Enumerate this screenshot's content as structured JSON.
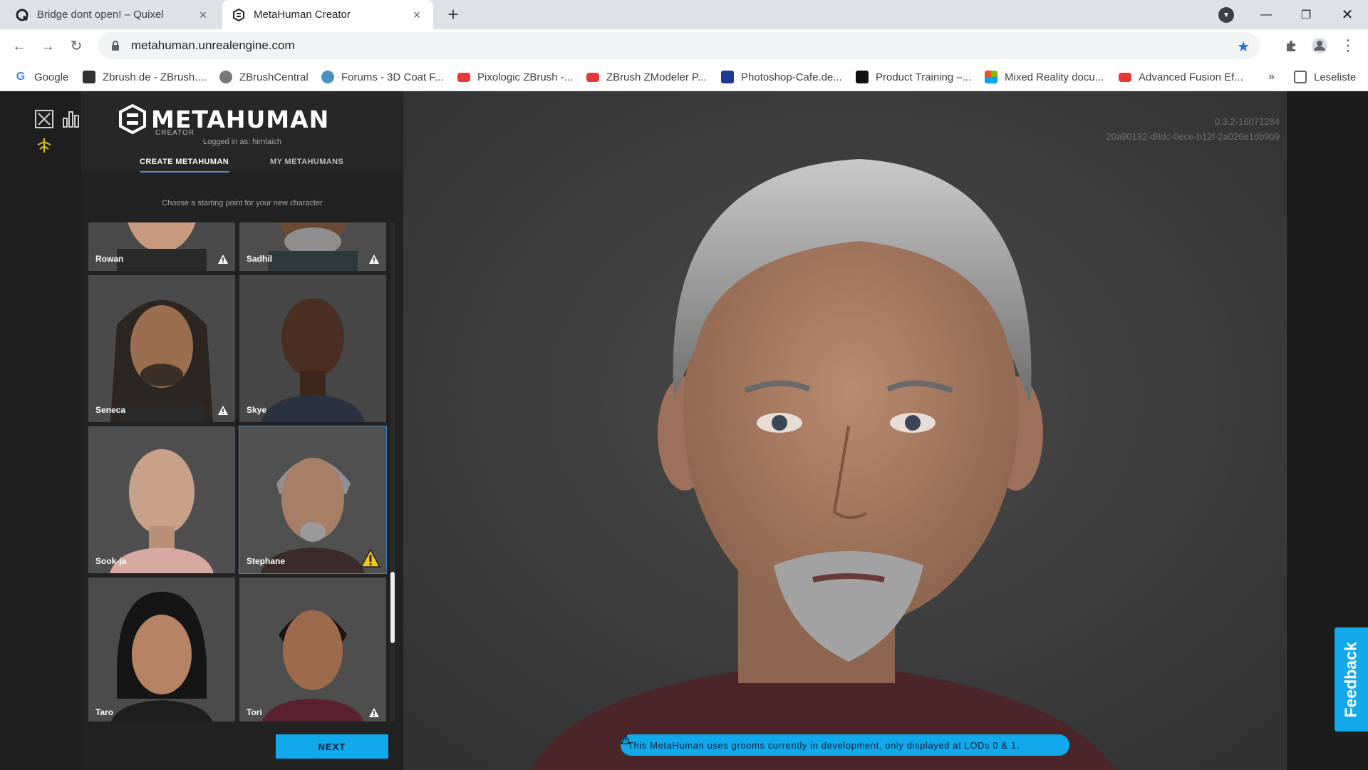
{
  "browser": {
    "tabs": [
      {
        "title": "Bridge dont open! – Quixel",
        "active": false
      },
      {
        "title": "MetaHuman Creator",
        "active": true
      }
    ],
    "url": "metahuman.unrealengine.com",
    "bookmarks": [
      {
        "label": "Google",
        "color": "#4285f4"
      },
      {
        "label": "Zbrush.de - ZBrush....",
        "color": "#333333"
      },
      {
        "label": "ZBrushCentral",
        "color": "#555555"
      },
      {
        "label": "Forums - 3D Coat F...",
        "color": "#4a90c2"
      },
      {
        "label": "Pixologic ZBrush -...",
        "color": "#e53935"
      },
      {
        "label": "ZBrush ZModeler P...",
        "color": "#e53935"
      },
      {
        "label": "Photoshop-Cafe.de...",
        "color": "#1f3a93"
      },
      {
        "label": "Product Training –...",
        "color": "#111111"
      },
      {
        "label": "Mixed Reality docu...",
        "color": "#f25022"
      },
      {
        "label": "Advanced Fusion Ef...",
        "color": "#e53935"
      }
    ],
    "bookmarks_overflow": "»",
    "reading_list": "Leseliste"
  },
  "app": {
    "logo_text": "METAHUMAN",
    "logo_sub": "CREATOR",
    "logged_in": "Logged in as: hirnlaich",
    "tabs": [
      "CREATE METAHUMAN",
      "MY METAHUMANS"
    ],
    "instruction": "Choose a starting point for your new character",
    "presets": [
      {
        "name": "Rowan",
        "warning": true
      },
      {
        "name": "Sadhil",
        "warning": true
      },
      {
        "name": "Seneca",
        "warning": true
      },
      {
        "name": "Skye",
        "warning": false
      },
      {
        "name": "Sook-ja",
        "warning": false
      },
      {
        "name": "Stephane",
        "warning": true,
        "selected": true
      },
      {
        "name": "Taro",
        "warning": false
      },
      {
        "name": "Tori",
        "warning": true
      }
    ],
    "next_label": "NEXT",
    "version": "0.3.2-16071284",
    "build_hash": "20a90132-d8dc-0ece-b12f-2a026e1db9b9",
    "banner": "This MetaHuman uses grooms currently in development, only displayed at LODs 0 & 1.",
    "feedback_label": "Feedback",
    "colors": {
      "accent": "#11a8ec",
      "selection": "#3f7fbf",
      "warning": "#f5c518"
    }
  }
}
